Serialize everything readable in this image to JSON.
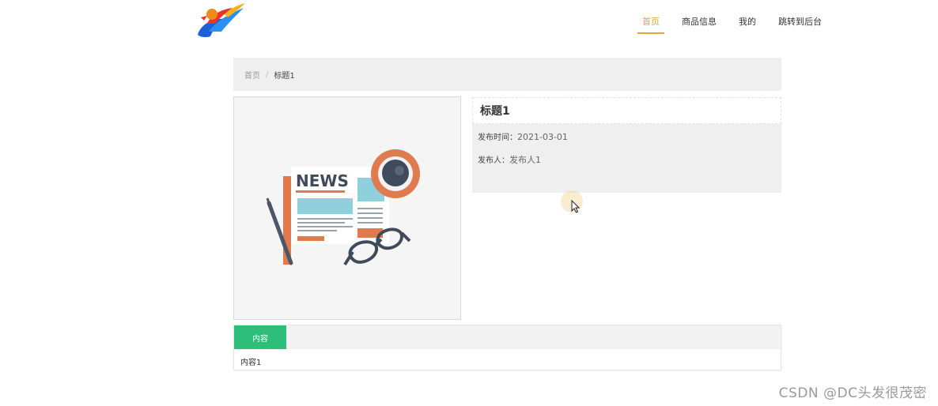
{
  "nav": {
    "items": [
      {
        "label": "首页",
        "active": true
      },
      {
        "label": "商品信息",
        "active": false
      },
      {
        "label": "我的",
        "active": false
      },
      {
        "label": "跳转到后台",
        "active": false
      }
    ]
  },
  "breadcrumb": {
    "home": "首页",
    "separator": "/",
    "current": "标题1"
  },
  "article_image": {
    "headline_text": "NEWS"
  },
  "info": {
    "title": "标题1",
    "publish_time_label": "发布时间：",
    "publish_time_value": "2021-03-01",
    "publisher_label": "发布人：",
    "publisher_value": "发布人1"
  },
  "content_tab": {
    "tab_label": "内容",
    "body": "内容1"
  },
  "watermark": "CSDN @DC头发很茂密",
  "colors": {
    "accent_nav": "#e6a23c",
    "tab_green": "#2dbe79",
    "panel_gray": "#efeff0"
  }
}
